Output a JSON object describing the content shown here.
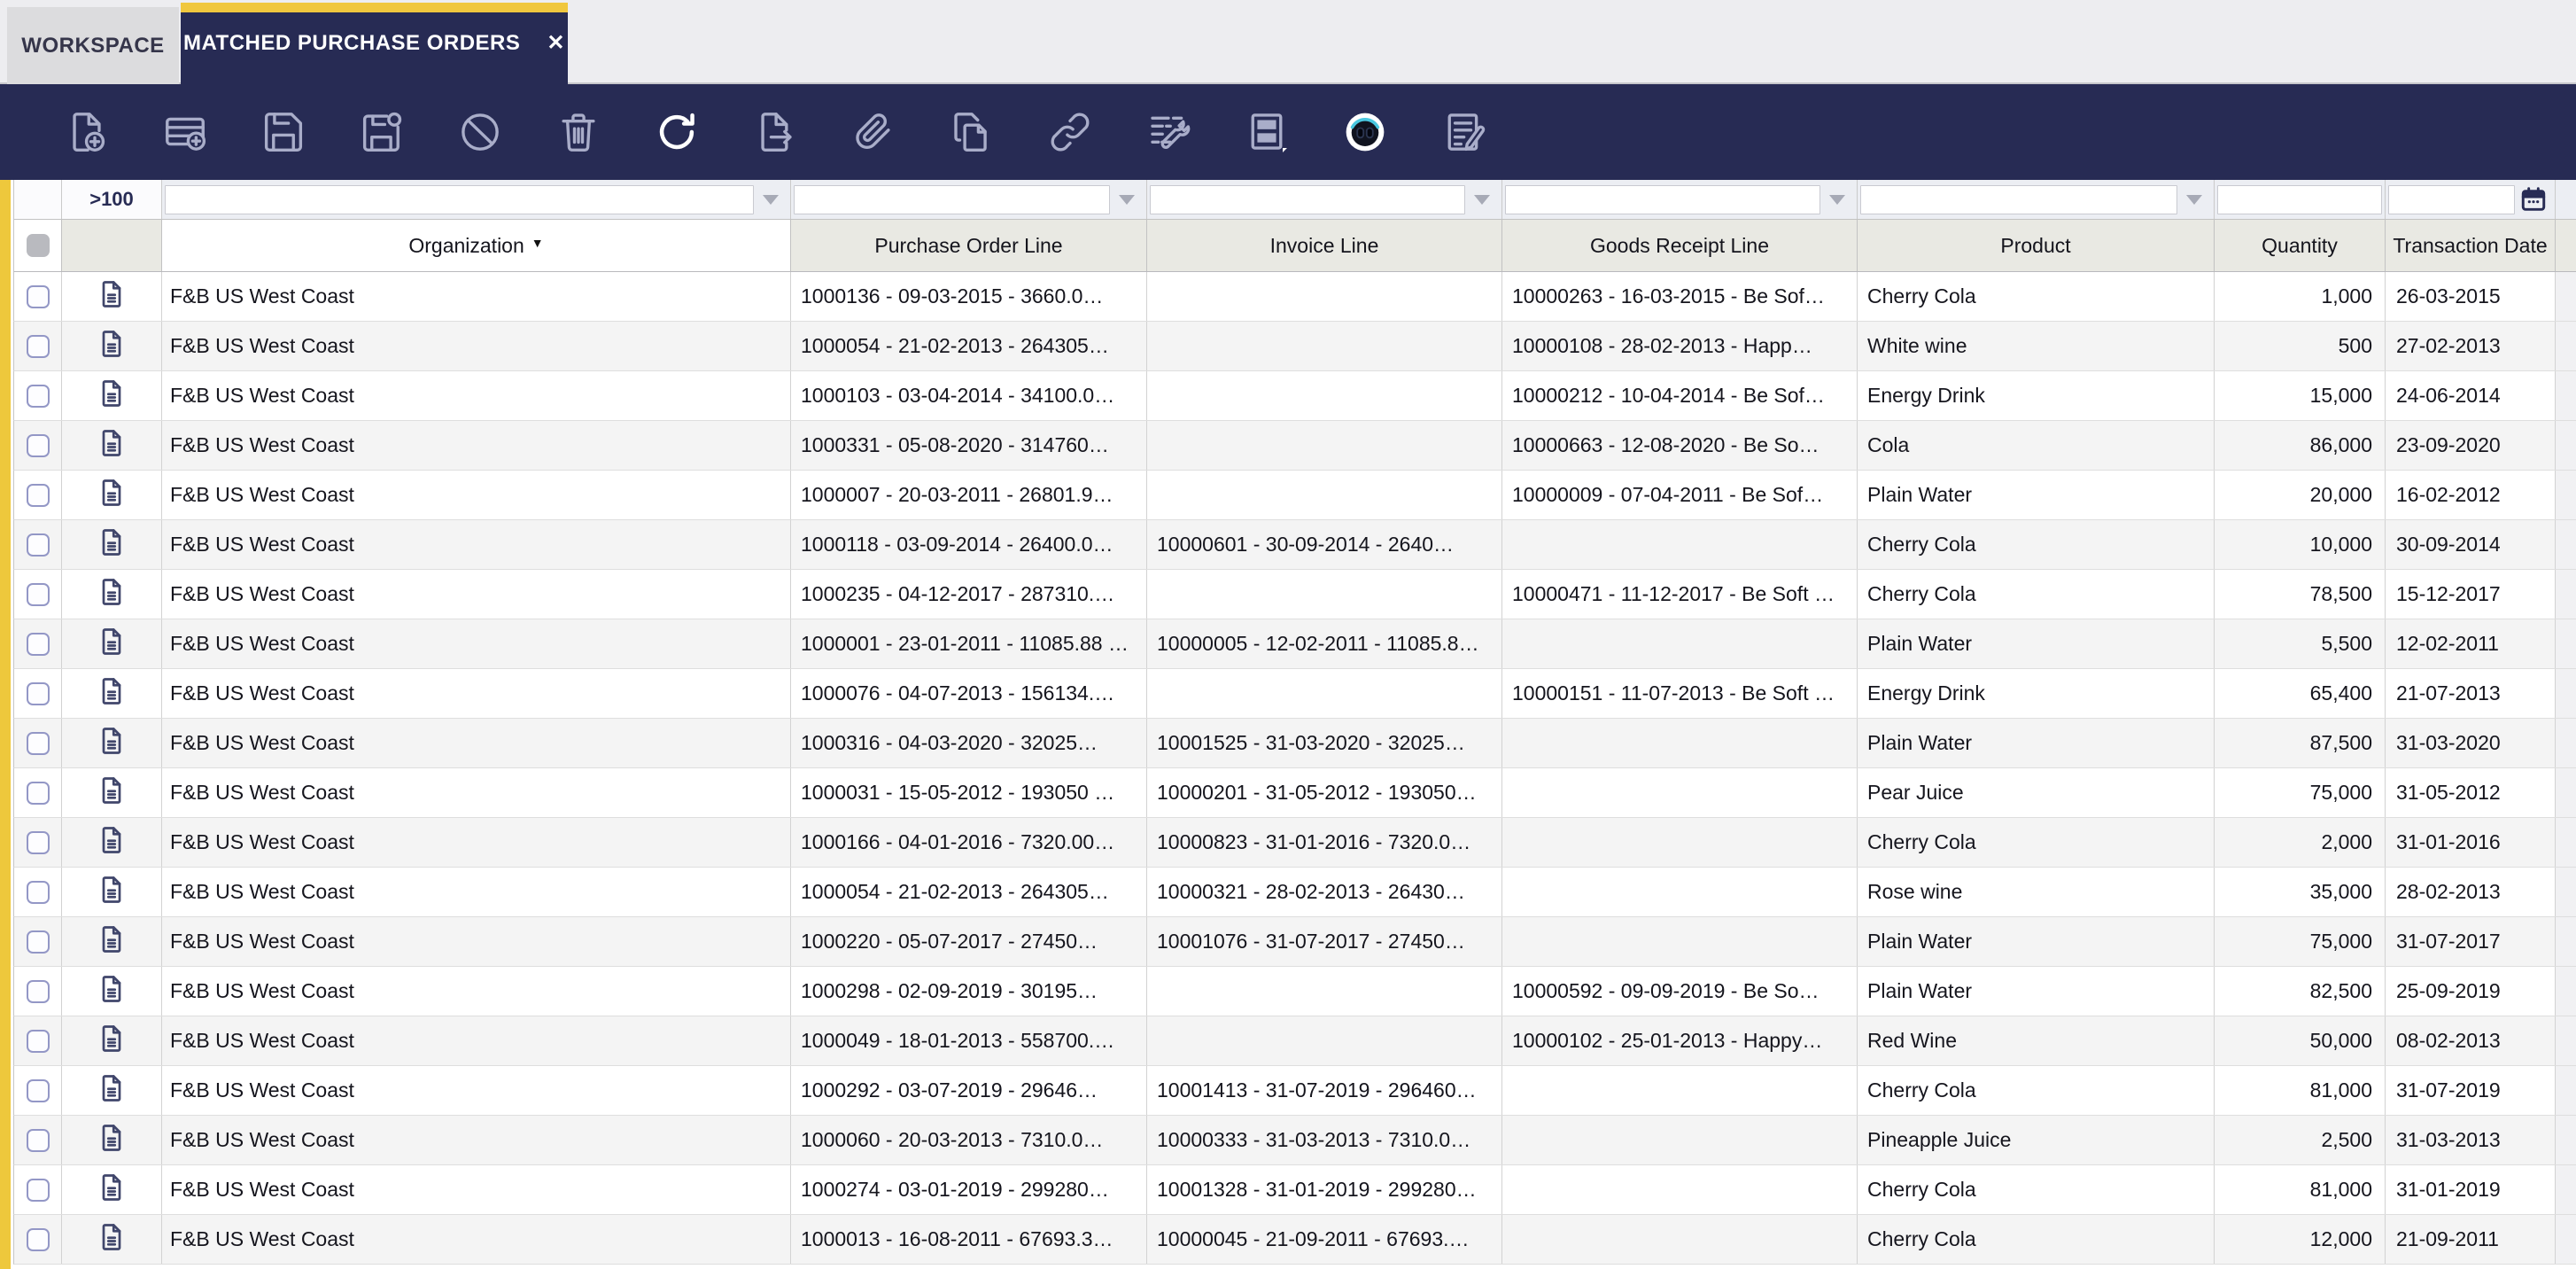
{
  "tabs": [
    {
      "label": "WORKSPACE",
      "active": false
    },
    {
      "label": "MATCHED PURCHASE ORDERS",
      "active": true,
      "close_glyph": "✕"
    }
  ],
  "toolbar": {
    "icons": [
      "new-document-icon",
      "insert-row-icon",
      "save-icon",
      "save-as-icon",
      "cancel-icon",
      "delete-icon",
      "refresh-icon",
      "export-icon",
      "attachment-icon",
      "copy-icon",
      "link-icon",
      "grid-settings-icon",
      "card-view-icon",
      "ai-assistant-icon",
      "notes-icon"
    ],
    "highlighted_icon": "refresh-icon"
  },
  "colors": {
    "navy": "#272b54",
    "accent_yellow": "#eec83c",
    "header_bg": "#e9e9e3",
    "row_alt_bg": "#f4f4f4"
  },
  "table": {
    "row_count_label": ">100",
    "sort": {
      "column": "Organization",
      "direction": "descending"
    },
    "filter_controls": [
      "dropdown",
      "dropdown",
      "dropdown",
      "dropdown",
      "dropdown",
      "text",
      "calendar"
    ],
    "columns": [
      {
        "key": "organization",
        "label": "Organization",
        "sort": "desc",
        "highlight": true
      },
      {
        "key": "purchase-order-line",
        "label": "Purchase Order Line"
      },
      {
        "key": "invoice-line",
        "label": "Invoice Line"
      },
      {
        "key": "goods-receipt-line",
        "label": "Goods Receipt Line"
      },
      {
        "key": "product",
        "label": "Product"
      },
      {
        "key": "quantity",
        "label": "Quantity"
      },
      {
        "key": "transaction-date",
        "label": "Transaction Date"
      }
    ],
    "rows": [
      {
        "organization": "F&B US West Coast",
        "purchase_order_line": "1000136 - 09-03-2015 - 3660.0…",
        "invoice_line": "",
        "goods_receipt_line": "10000263 - 16-03-2015 - Be Sof…",
        "product": "Cherry Cola",
        "quantity": "1,000",
        "transaction_date": "26-03-2015"
      },
      {
        "organization": "F&B US West Coast",
        "purchase_order_line": "1000054 - 21-02-2013 - 264305…",
        "invoice_line": "",
        "goods_receipt_line": "10000108 - 28-02-2013 - Happ…",
        "product": "White wine",
        "quantity": "500",
        "transaction_date": "27-02-2013"
      },
      {
        "organization": "F&B US West Coast",
        "purchase_order_line": "1000103 - 03-04-2014 - 34100.0…",
        "invoice_line": "",
        "goods_receipt_line": "10000212 - 10-04-2014 - Be Sof…",
        "product": "Energy Drink",
        "quantity": "15,000",
        "transaction_date": "24-06-2014"
      },
      {
        "organization": "F&B US West Coast",
        "purchase_order_line": "1000331 - 05-08-2020 - 314760…",
        "invoice_line": "",
        "goods_receipt_line": "10000663 - 12-08-2020 - Be So…",
        "product": "Cola",
        "quantity": "86,000",
        "transaction_date": "23-09-2020"
      },
      {
        "organization": "F&B US West Coast",
        "purchase_order_line": "1000007 - 20-03-2011 - 26801.9…",
        "invoice_line": "",
        "goods_receipt_line": "10000009 - 07-04-2011 - Be Sof…",
        "product": "Plain Water",
        "quantity": "20,000",
        "transaction_date": "16-02-2012"
      },
      {
        "organization": "F&B US West Coast",
        "purchase_order_line": "1000118 - 03-09-2014 - 26400.0…",
        "invoice_line": "10000601 - 30-09-2014 - 2640…",
        "goods_receipt_line": "",
        "product": "Cherry Cola",
        "quantity": "10,000",
        "transaction_date": "30-09-2014"
      },
      {
        "organization": "F&B US West Coast",
        "purchase_order_line": "1000235 - 04-12-2017 - 287310.…",
        "invoice_line": "",
        "goods_receipt_line": "10000471 - 11-12-2017 - Be Soft …",
        "product": "Cherry Cola",
        "quantity": "78,500",
        "transaction_date": "15-12-2017"
      },
      {
        "organization": "F&B US West Coast",
        "purchase_order_line": "1000001 - 23-01-2011 - 11085.88 …",
        "invoice_line": "10000005 - 12-02-2011 - 11085.8…",
        "goods_receipt_line": "",
        "product": "Plain Water",
        "quantity": "5,500",
        "transaction_date": "12-02-2011"
      },
      {
        "organization": "F&B US West Coast",
        "purchase_order_line": "1000076 - 04-07-2013 - 156134.…",
        "invoice_line": "",
        "goods_receipt_line": "10000151 - 11-07-2013 - Be Soft …",
        "product": "Energy Drink",
        "quantity": "65,400",
        "transaction_date": "21-07-2013"
      },
      {
        "organization": "F&B US West Coast",
        "purchase_order_line": "1000316 - 04-03-2020 - 32025…",
        "invoice_line": "10001525 - 31-03-2020 - 32025…",
        "goods_receipt_line": "",
        "product": "Plain Water",
        "quantity": "87,500",
        "transaction_date": "31-03-2020"
      },
      {
        "organization": "F&B US West Coast",
        "purchase_order_line": "1000031 - 15-05-2012 - 193050 …",
        "invoice_line": "10000201 - 31-05-2012 - 193050…",
        "goods_receipt_line": "",
        "product": "Pear Juice",
        "quantity": "75,000",
        "transaction_date": "31-05-2012"
      },
      {
        "organization": "F&B US West Coast",
        "purchase_order_line": "1000166 - 04-01-2016 - 7320.00…",
        "invoice_line": "10000823 - 31-01-2016 - 7320.0…",
        "goods_receipt_line": "",
        "product": "Cherry Cola",
        "quantity": "2,000",
        "transaction_date": "31-01-2016"
      },
      {
        "organization": "F&B US West Coast",
        "purchase_order_line": "1000054 - 21-02-2013 - 264305…",
        "invoice_line": "10000321 - 28-02-2013 - 26430…",
        "goods_receipt_line": "",
        "product": "Rose wine",
        "quantity": "35,000",
        "transaction_date": "28-02-2013"
      },
      {
        "organization": "F&B US West Coast",
        "purchase_order_line": "1000220 - 05-07-2017 - 27450…",
        "invoice_line": "10001076 - 31-07-2017 - 27450…",
        "goods_receipt_line": "",
        "product": "Plain Water",
        "quantity": "75,000",
        "transaction_date": "31-07-2017"
      },
      {
        "organization": "F&B US West Coast",
        "purchase_order_line": "1000298 - 02-09-2019 - 30195…",
        "invoice_line": "",
        "goods_receipt_line": "10000592 - 09-09-2019 - Be So…",
        "product": "Plain Water",
        "quantity": "82,500",
        "transaction_date": "25-09-2019"
      },
      {
        "organization": "F&B US West Coast",
        "purchase_order_line": "1000049 - 18-01-2013 - 558700.…",
        "invoice_line": "",
        "goods_receipt_line": "10000102 - 25-01-2013 - Happy…",
        "product": "Red Wine",
        "quantity": "50,000",
        "transaction_date": "08-02-2013"
      },
      {
        "organization": "F&B US West Coast",
        "purchase_order_line": "1000292 - 03-07-2019 - 29646…",
        "invoice_line": "10001413 - 31-07-2019 - 296460…",
        "goods_receipt_line": "",
        "product": "Cherry Cola",
        "quantity": "81,000",
        "transaction_date": "31-07-2019"
      },
      {
        "organization": "F&B US West Coast",
        "purchase_order_line": "1000060 - 20-03-2013 - 7310.0…",
        "invoice_line": "10000333 - 31-03-2013 - 7310.0…",
        "goods_receipt_line": "",
        "product": "Pineapple Juice",
        "quantity": "2,500",
        "transaction_date": "31-03-2013"
      },
      {
        "organization": "F&B US West Coast",
        "purchase_order_line": "1000274 - 03-01-2019 - 299280…",
        "invoice_line": "10001328 - 31-01-2019 - 299280…",
        "goods_receipt_line": "",
        "product": "Cherry Cola",
        "quantity": "81,000",
        "transaction_date": "31-01-2019"
      },
      {
        "organization": "F&B US West Coast",
        "purchase_order_line": "1000013 - 16-08-2011 - 67693.3…",
        "invoice_line": "10000045 - 21-09-2011 - 67693.…",
        "goods_receipt_line": "",
        "product": "Cherry Cola",
        "quantity": "12,000",
        "transaction_date": "21-09-2011"
      }
    ]
  }
}
